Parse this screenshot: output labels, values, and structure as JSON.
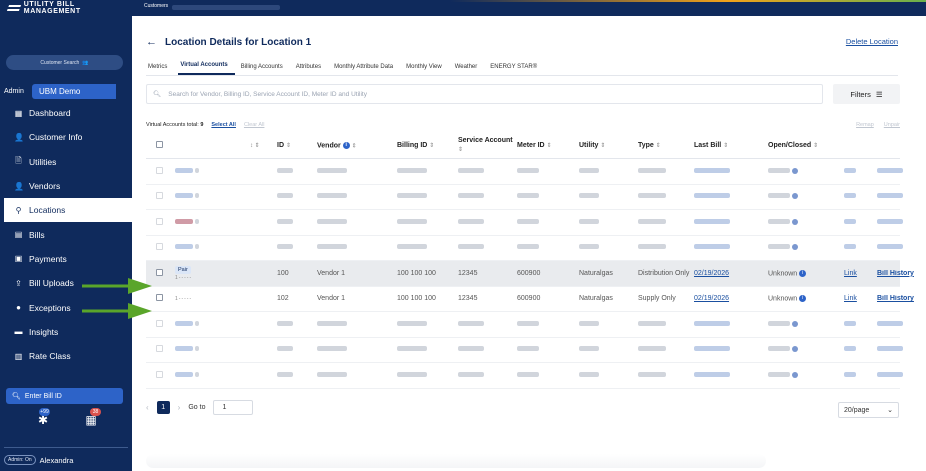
{
  "brand": {
    "name": "UTILITY BILL MANAGEMENT"
  },
  "topbar": {
    "breadcrumb": "Customers"
  },
  "sidebar": {
    "customer_search": "Customer Search",
    "admin_label": "Admin",
    "org_name": "UBM Demo",
    "items": [
      {
        "label": "Dashboard",
        "icon": "dashboard-icon",
        "glyph": "▦"
      },
      {
        "label": "Customer Info",
        "icon": "person-icon",
        "glyph": "👤"
      },
      {
        "label": "Utilities",
        "icon": "utility-icon",
        "glyph": "🗎"
      },
      {
        "label": "Vendors",
        "icon": "person-icon",
        "glyph": "👤"
      },
      {
        "label": "Locations",
        "icon": "pin-icon",
        "glyph": "⚲"
      },
      {
        "label": "Bills",
        "icon": "bill-icon",
        "glyph": "▤"
      },
      {
        "label": "Payments",
        "icon": "payment-icon",
        "glyph": "▣"
      },
      {
        "label": "Bill Uploads",
        "icon": "upload-icon",
        "glyph": "⇪"
      },
      {
        "label": "Exceptions",
        "icon": "alert-icon",
        "glyph": "●"
      },
      {
        "label": "Insights",
        "icon": "insights-icon",
        "glyph": "▬"
      },
      {
        "label": "Rate Class",
        "icon": "rate-class-icon",
        "glyph": "▥"
      }
    ],
    "active_item": "Locations",
    "enter_bill": "Enter Bill ID",
    "badge_tasks": "+99",
    "badge_calendar": "38",
    "admin_pill": "Admin: On",
    "user_name": "Alexandra"
  },
  "main": {
    "title_prefix": "Location Details for",
    "title_location": "Location 1",
    "delete_label": "Delete Location",
    "tabs": [
      "Metrics",
      "Virtual Accounts",
      "Billing Accounts",
      "Attributes",
      "Monthly Attribute Data",
      "Monthly View",
      "Weather",
      "ENERGY STAR®"
    ],
    "active_tab": "Virtual Accounts",
    "search_placeholder": "Search for Vendor, Billing ID, Service Account ID, Meter ID and Utility",
    "filters_label": "Filters",
    "va_total_label": "Virtual Accounts total:",
    "va_total_value": "9",
    "select_all": "Select All",
    "clear_all": "Clear All",
    "remap": "Remap",
    "unpair": "Unpair"
  },
  "table": {
    "headers": {
      "id": "ID",
      "vendor": "Vendor",
      "billing_id": "Billing ID",
      "service_account": "Service Account",
      "meter_id": "Meter ID",
      "utility": "Utility",
      "type": "Type",
      "last_bill": "Last Bill",
      "open_closed": "Open/Closed"
    },
    "clear_rows": [
      {
        "badge": "Pair",
        "id": "100",
        "vendor": "Vendor 1",
        "billing_id": "100 100 100",
        "service_account": "12345",
        "meter_id": "600900",
        "utility": "Naturalgas",
        "type": "Distribution Only",
        "last_bill": "02/19/2026",
        "status": "Unknown",
        "link": "Link",
        "history": "Bill History"
      },
      {
        "badge": "",
        "id": "102",
        "vendor": "Vendor 1",
        "billing_id": "100 100 100",
        "service_account": "12345",
        "meter_id": "600900",
        "utility": "Naturalgas",
        "type": "Supply Only",
        "last_bill": "02/19/2026",
        "status": "Unknown",
        "link": "Link",
        "history": "Bill History"
      }
    ],
    "sub_dash": "1-----"
  },
  "pagination": {
    "current_page": "1",
    "goto_label": "Go to",
    "goto_value": "1",
    "per_page": "20/page"
  },
  "colors": {
    "sidebar": "#0f2a5c",
    "accent": "#2d63c8",
    "annotation_arrow": "#5aa52a",
    "badge_tasks": "#2d63c8",
    "badge_calendar": "#d9534f"
  }
}
